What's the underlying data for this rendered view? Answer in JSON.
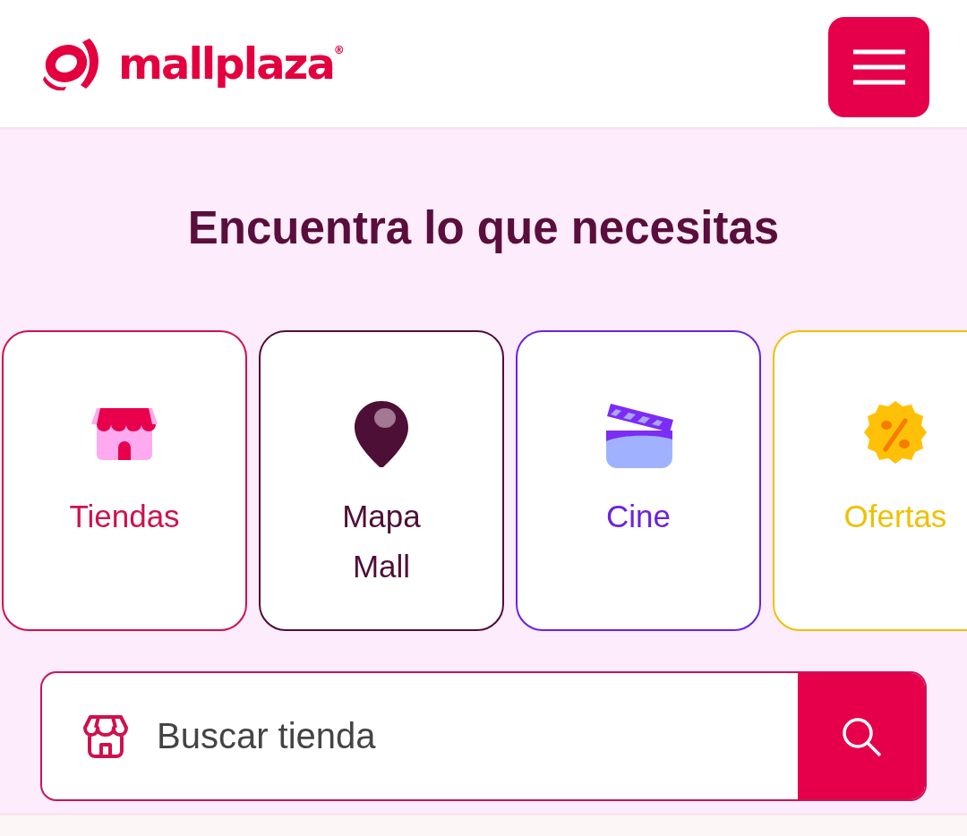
{
  "header": {
    "logo": "mallplaza$^{®}$"
  },
  "heading": "Encuentra lo que necesitas",
  "categories": [
    {
      "label": "Tiendas",
      "kind": "store",
      "color": "#d0104c"
    },
    {
      "label": "Mapa Mall",
      "kind": "pin",
      "color": "#4e0f37"
    },
    {
      "label": "Cine",
      "kind": "clapper",
      "color": "#6a22e0"
    },
    {
      "label": "Ofertas",
      "kind": "discount",
      "color": "#f0c000"
    }
  ],
  "search": {
    "placeholder": "Buscar tienda"
  }
}
